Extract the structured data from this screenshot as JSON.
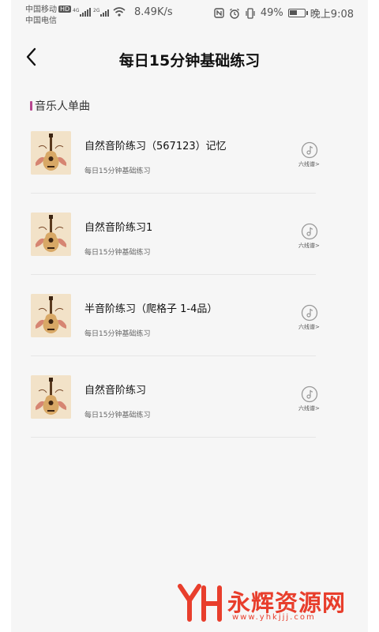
{
  "status_bar": {
    "carrier1": "中国移动",
    "hd_badge": "HD",
    "carrier2": "中国电信",
    "net_speed": "8.49K/s",
    "battery": "49%",
    "time": "晚上9:08"
  },
  "header": {
    "title": "每日15分钟基础练习"
  },
  "section": {
    "title": "音乐人单曲"
  },
  "songs": [
    {
      "title": "自然音阶练习（567123）记忆",
      "subtitle": "每日15分钟基础练习",
      "tab_label": "六线谱>"
    },
    {
      "title": "自然音阶练习1",
      "subtitle": "每日15分钟基础练习",
      "tab_label": "六线谱>"
    },
    {
      "title": "半音阶练习（爬格子 1-4品）",
      "subtitle": "每日15分钟基础练习",
      "tab_label": "六线谱>"
    },
    {
      "title": "自然音阶练习",
      "subtitle": "每日15分钟基础练习",
      "tab_label": "六线谱>"
    }
  ],
  "watermark": {
    "text": "永辉资源网",
    "url": "www.yhkjjj.com"
  },
  "colors": {
    "accent": "#b7468f",
    "watermark": "#e83e2c",
    "background": "#f6f6f6"
  }
}
